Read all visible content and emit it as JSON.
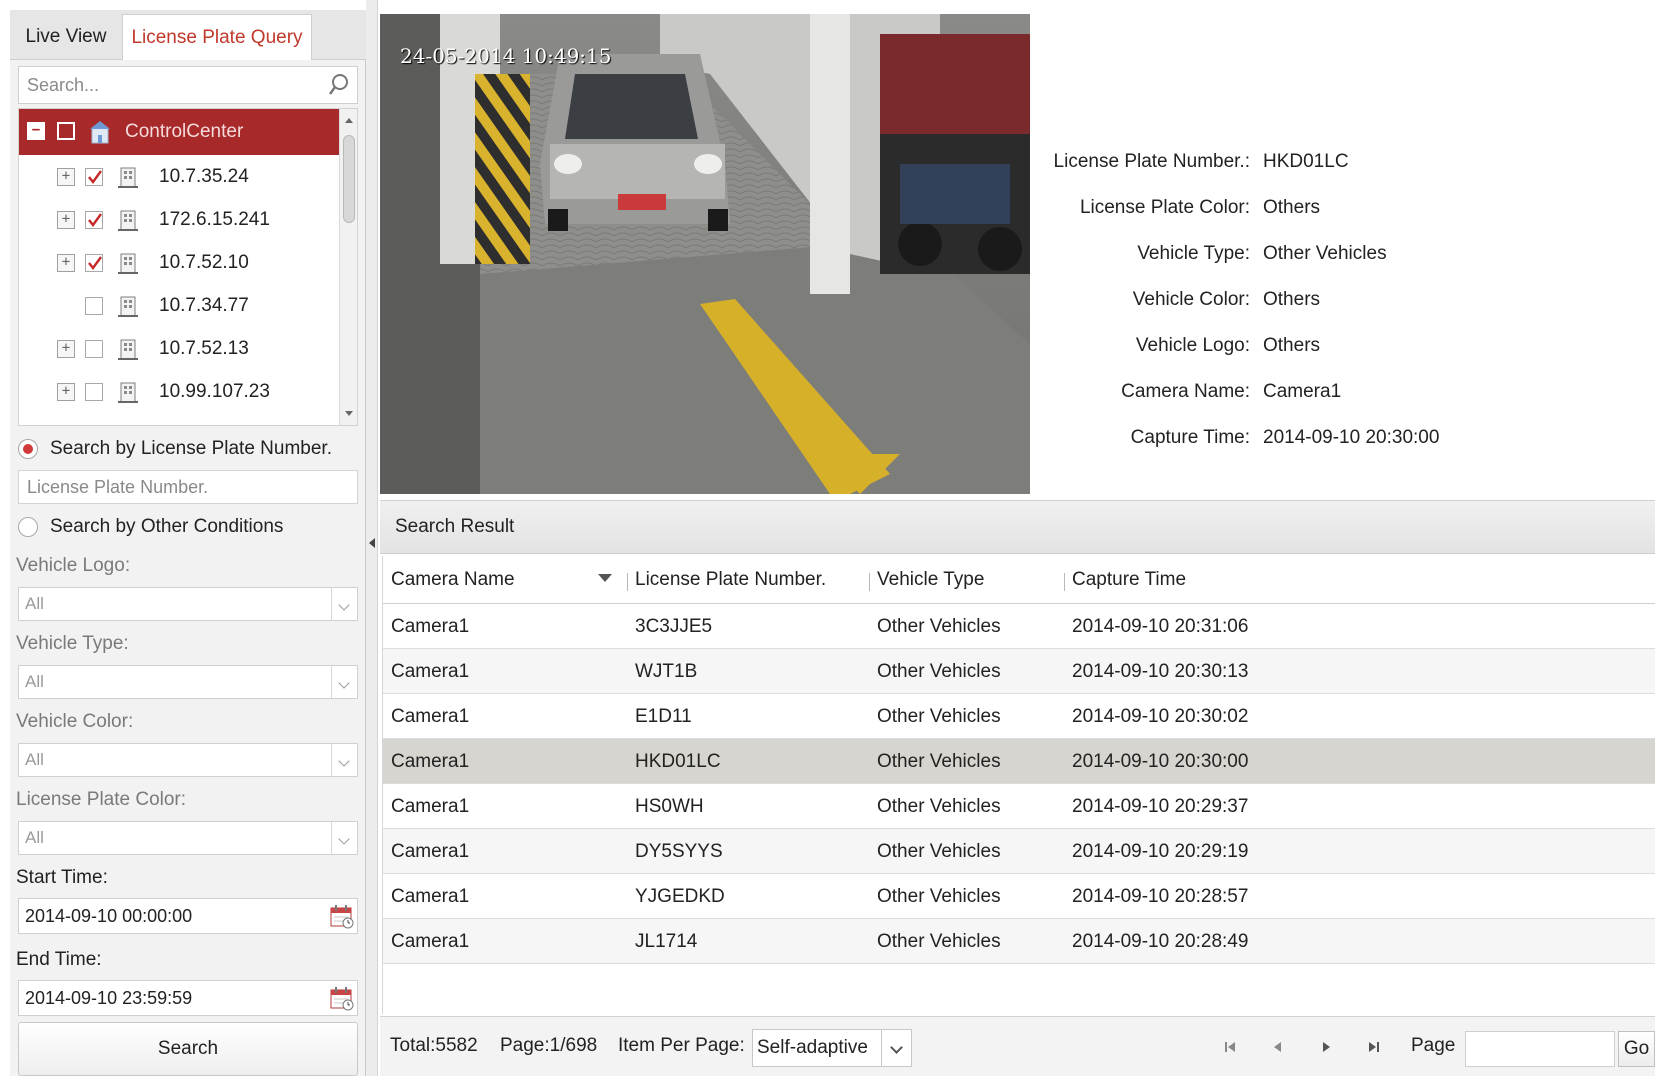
{
  "tabs": {
    "live_view": "Live View",
    "plate_query": "License Plate Query"
  },
  "search": {
    "placeholder": "Search..."
  },
  "tree": {
    "root": "ControlCenter",
    "items": [
      {
        "label": "10.7.35.24",
        "expandable": true,
        "checked": true
      },
      {
        "label": "172.6.15.241",
        "expandable": true,
        "checked": true
      },
      {
        "label": "10.7.52.10",
        "expandable": true,
        "checked": true
      },
      {
        "label": "10.7.34.77",
        "expandable": false,
        "checked": false
      },
      {
        "label": "10.7.52.13",
        "expandable": true,
        "checked": false
      },
      {
        "label": "10.99.107.23",
        "expandable": true,
        "checked": false
      }
    ]
  },
  "filters": {
    "by_plate_label": "Search by License Plate Number.",
    "plate_placeholder": "License Plate Number.",
    "by_other_label": "Search by Other Conditions",
    "vehicle_logo_label": "Vehicle Logo:",
    "vehicle_logo_value": "All",
    "vehicle_type_label": "Vehicle Type:",
    "vehicle_type_value": "All",
    "vehicle_color_label": "Vehicle Color:",
    "vehicle_color_value": "All",
    "plate_color_label": "License Plate Color:",
    "plate_color_value": "All",
    "start_label": "Start Time:",
    "start_value": "2014-09-10 00:00:00",
    "end_label": "End Time:",
    "end_value": "2014-09-10 23:59:59",
    "search_button": "Search"
  },
  "preview": {
    "osd_time": "24-05-2014 10:49:15"
  },
  "details": {
    "plate_number_label": "License Plate Number.:",
    "plate_number": "HKD01LC",
    "plate_color_label": "License Plate Color:",
    "plate_color": "Others",
    "vehicle_type_label": "Vehicle Type:",
    "vehicle_type": "Other Vehicles",
    "vehicle_color_label": "Vehicle Color:",
    "vehicle_color": "Others",
    "vehicle_logo_label": "Vehicle Logo:",
    "vehicle_logo": "Others",
    "camera_name_label": "Camera Name:",
    "camera_name": "Camera1",
    "capture_time_label": "Capture Time:",
    "capture_time": "2014-09-10 20:30:00"
  },
  "results": {
    "title": "Search Result",
    "columns": [
      "Camera Name",
      "License Plate Number.",
      "Vehicle Type",
      "Capture Time"
    ],
    "rows": [
      [
        "Camera1",
        "3C3JJE5",
        "Other Vehicles",
        "2014-09-10 20:31:06"
      ],
      [
        "Camera1",
        "WJT1B",
        "Other Vehicles",
        "2014-09-10 20:30:13"
      ],
      [
        "Camera1",
        "E1D11",
        "Other Vehicles",
        "2014-09-10 20:30:02"
      ],
      [
        "Camera1",
        "HKD01LC",
        "Other Vehicles",
        "2014-09-10 20:30:00"
      ],
      [
        "Camera1",
        "HS0WH",
        "Other Vehicles",
        "2014-09-10 20:29:37"
      ],
      [
        "Camera1",
        "DY5SYYS",
        "Other Vehicles",
        "2014-09-10 20:29:19"
      ],
      [
        "Camera1",
        "YJGEDKD",
        "Other Vehicles",
        "2014-09-10 20:28:57"
      ],
      [
        "Camera1",
        "JL1714",
        "Other Vehicles",
        "2014-09-10 20:28:49"
      ]
    ],
    "selected_row": 3
  },
  "pager": {
    "total": "Total:5582",
    "page": "Page:1/698",
    "item_per_page_label": "Item Per Page:",
    "item_per_page_value": "Self-adaptive",
    "page_label": "Page",
    "go": "Go"
  },
  "colors": {
    "accent_red": "#a8292a",
    "tab_red": "#c0392b"
  }
}
